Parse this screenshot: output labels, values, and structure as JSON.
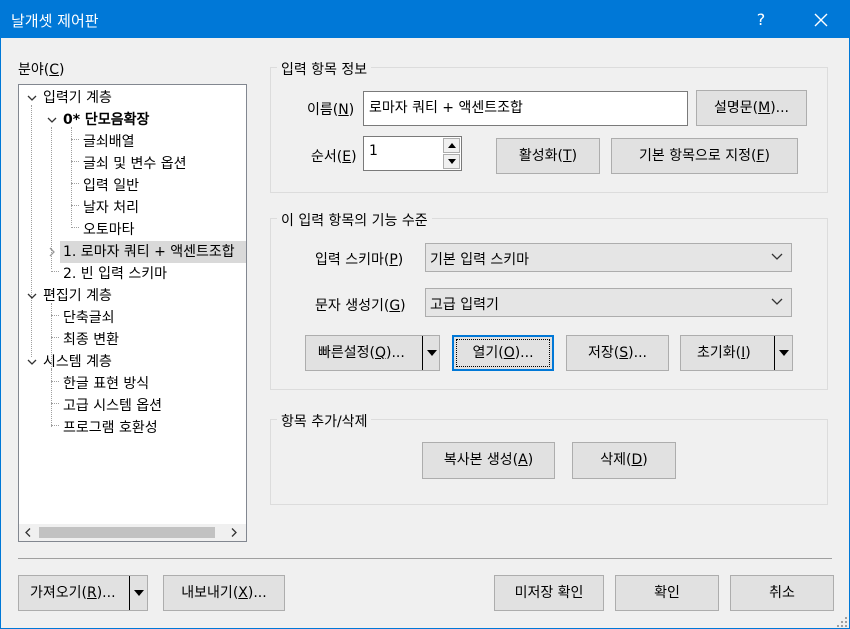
{
  "window": {
    "title": "날개셋 제어판",
    "help": "?"
  },
  "category": {
    "label": "분야(",
    "hot": "C",
    "end": ")"
  },
  "tree": [
    {
      "text": "입력기 계층",
      "bold": false
    },
    {
      "text": "0* 단모음확장",
      "bold": true
    },
    {
      "text": "글쇠배열"
    },
    {
      "text": "글쇠 및 변수 옵션"
    },
    {
      "text": "입력 일반"
    },
    {
      "text": "날자 처리"
    },
    {
      "text": "오토마타"
    },
    {
      "text": "1. 로마자 쿼티 + 액센트조합"
    },
    {
      "text": "2. 빈 입력 스키마"
    },
    {
      "text": "편집기 계층"
    },
    {
      "text": "단축글쇠"
    },
    {
      "text": "최종 변환"
    },
    {
      "text": "시스템 계층"
    },
    {
      "text": "한글 표현 방식"
    },
    {
      "text": "고급 시스템 옵션"
    },
    {
      "text": "프로그램 호환성"
    }
  ],
  "info": {
    "title": "입력 항목 정보",
    "name_label": "이름(",
    "name_hot": "N",
    "name_end": ")",
    "name_value": "로마자 쿼티 + 액센트조합",
    "desc_btn": "설명문(",
    "desc_hot": "M",
    "desc_end": ")...",
    "order_label": "순서(",
    "order_hot": "E",
    "order_end": ")",
    "order_value": "1",
    "activate_btn": "활성화(",
    "activate_hot": "T",
    "activate_end": ")",
    "default_btn": "기본 항목으로 지정(",
    "default_hot": "F",
    "default_end": ")"
  },
  "func": {
    "title": "이 입력 항목의 기능 수준",
    "schema_label": "입력 스키마(",
    "schema_hot": "P",
    "schema_end": ")",
    "schema_value": "기본 입력 스키마",
    "gen_label": "문자 생성기(",
    "gen_hot": "G",
    "gen_end": ")",
    "gen_value": "고급 입력기",
    "quick_btn": "빠른설정(",
    "quick_hot": "Q",
    "quick_end": ")...",
    "open_btn": "열기(",
    "open_hot": "O",
    "open_end": ")...",
    "save_btn": "저장(",
    "save_hot": "S",
    "save_end": ")...",
    "reset_btn": "초기화(",
    "reset_hot": "I",
    "reset_end": ")"
  },
  "addremove": {
    "title": "항목 추가/삭제",
    "copy_btn": "복사본 생성(",
    "copy_hot": "A",
    "copy_end": ")",
    "delete_btn": "삭제(",
    "delete_hot": "D",
    "delete_end": ")"
  },
  "footer": {
    "import_btn": "가져오기(",
    "import_hot": "R",
    "import_end": ")...",
    "export_btn": "내보내기(",
    "export_hot": "X",
    "export_end": ")...",
    "unsaved_btn": "미저장 확인",
    "ok_btn": "확인",
    "cancel_btn": "취소"
  },
  "colors": {
    "accent": "#0078d7",
    "selection": "#d9d9d9"
  }
}
